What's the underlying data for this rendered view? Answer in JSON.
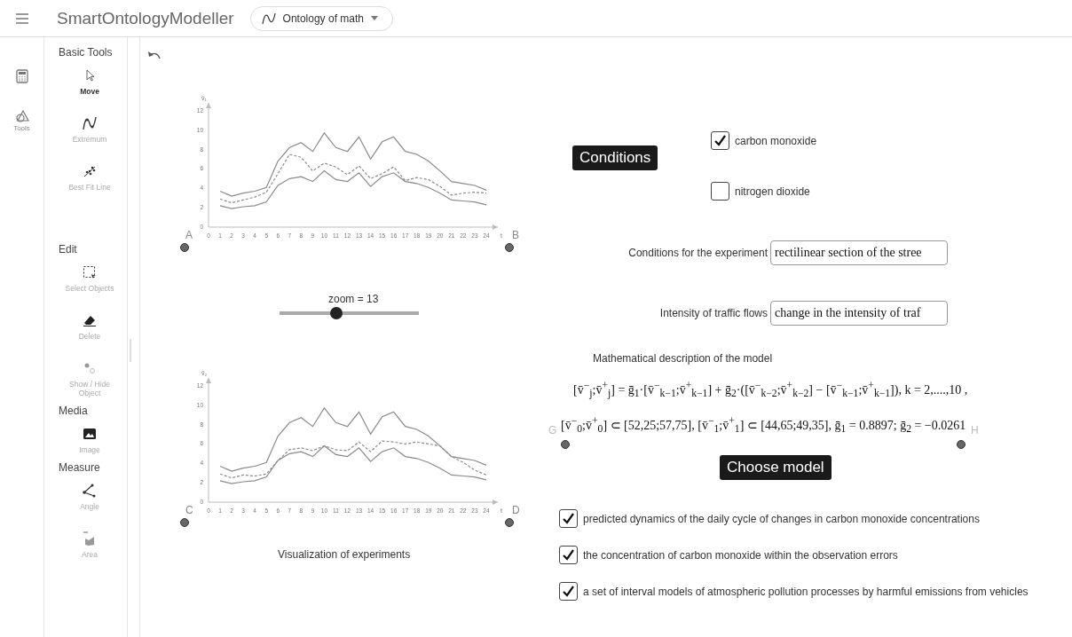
{
  "app_title": "SmartOntologyModeller",
  "file_selector": {
    "label": "Ontology of math"
  },
  "rail": [
    {
      "kind": "calculator"
    },
    {
      "kind": "tools",
      "label": "Tools"
    }
  ],
  "tool_sections": [
    {
      "title": "Basic Tools",
      "tools": [
        {
          "kind": "move",
          "label": "Move",
          "selected": true
        },
        {
          "kind": "extremum",
          "label": "Extremum",
          "selected": false
        },
        {
          "kind": "fit",
          "label": "Best Fit Line",
          "selected": false
        }
      ]
    },
    {
      "title": "Edit",
      "tools": [
        {
          "kind": "select",
          "label": "Select Objects",
          "selected": false
        },
        {
          "kind": "delete",
          "label": "Delete",
          "selected": false
        },
        {
          "kind": "showhide",
          "label": "Show / Hide Object",
          "selected": false
        }
      ]
    },
    {
      "title": "Media",
      "tools": [
        {
          "kind": "image",
          "label": "Image",
          "selected": false
        }
      ]
    },
    {
      "title": "Measure",
      "tools": [
        {
          "kind": "angle",
          "label": "Angle",
          "selected": false
        },
        {
          "kind": "area",
          "label": "Area",
          "selected": false
        }
      ]
    }
  ],
  "charts": [
    {
      "points": [
        "A",
        "B"
      ],
      "chart_data": {
        "type": "line",
        "xlabel": "t",
        "ylabel": "v̄₁",
        "x": [
          1,
          2,
          3,
          4,
          5,
          6,
          7,
          8,
          9,
          10,
          11,
          12,
          13,
          14,
          15,
          16,
          17,
          18,
          19,
          20,
          21,
          22,
          23,
          24
        ],
        "xticks": [
          0,
          1,
          2,
          3,
          4,
          5,
          6,
          7,
          8,
          9,
          10,
          11,
          12,
          13,
          14,
          15,
          16,
          17,
          18,
          19,
          20,
          21,
          22,
          23,
          24
        ],
        "yticks": [
          0,
          2,
          4,
          6,
          8,
          10,
          12
        ],
        "xlim": [
          0,
          25
        ],
        "ylim": [
          0,
          12.8
        ],
        "series": [
          {
            "color": "#8a8a8a",
            "line_style": "solid",
            "values": [
              3.7,
              3.2,
              3.5,
              3.7,
              4.1,
              6.8,
              8.2,
              8.7,
              7.8,
              9.7,
              8.2,
              7.8,
              9.3,
              7.0,
              8.8,
              9.3,
              7.8,
              7.5,
              6.8,
              5.8,
              4.7,
              4.5,
              4.3,
              3.8
            ]
          },
          {
            "color": "#8a8a8a",
            "line_style": "dashed",
            "values": [
              2.9,
              2.5,
              2.8,
              3.1,
              3.6,
              5.5,
              7.5,
              7.2,
              5.8,
              6.6,
              6.2,
              5.4,
              6.3,
              5.0,
              5.5,
              6.2,
              4.8,
              5.1,
              4.9,
              4.2,
              3.3,
              3.5,
              3.6,
              3.5
            ]
          },
          {
            "color": "#8a8a8a",
            "line_style": "solid",
            "values": [
              2.2,
              1.9,
              2.1,
              2.2,
              2.6,
              4.3,
              5.0,
              5.2,
              4.7,
              5.8,
              4.9,
              4.7,
              5.6,
              4.2,
              5.2,
              5.6,
              4.7,
              4.5,
              4.1,
              3.5,
              2.8,
              2.7,
              2.6,
              2.3
            ]
          }
        ]
      }
    },
    {
      "points": [
        "C",
        "D"
      ],
      "chart_data": {
        "type": "line",
        "xlabel": "t",
        "ylabel": "v̄₂",
        "x": [
          1,
          2,
          3,
          4,
          5,
          6,
          7,
          8,
          9,
          10,
          11,
          12,
          13,
          14,
          15,
          16,
          17,
          18,
          19,
          20,
          21,
          22,
          23,
          24
        ],
        "xticks": [
          0,
          1,
          2,
          3,
          4,
          5,
          6,
          7,
          8,
          9,
          10,
          11,
          12,
          13,
          14,
          15,
          16,
          17,
          18,
          19,
          20,
          21,
          22,
          23,
          24
        ],
        "yticks": [
          0,
          2,
          4,
          6,
          8,
          10,
          12
        ],
        "xlim": [
          0,
          25
        ],
        "ylim": [
          0,
          12.8
        ],
        "series": [
          {
            "color": "#8a8a8a",
            "line_style": "solid",
            "values": [
              3.7,
              3.2,
              3.5,
              3.7,
              4.1,
              6.8,
              8.2,
              8.7,
              7.8,
              9.7,
              8.2,
              7.8,
              9.3,
              7.0,
              8.8,
              9.3,
              7.8,
              7.5,
              6.8,
              5.8,
              4.7,
              4.5,
              4.3,
              3.8
            ]
          },
          {
            "color": "#8a8a8a",
            "line_style": "dashed",
            "values": [
              2.9,
              2.5,
              2.8,
              2.7,
              2.9,
              4.3,
              5.4,
              5.6,
              5.3,
              5.8,
              5.4,
              5.3,
              6.2,
              5.2,
              6.3,
              6.2,
              6.0,
              6.2,
              6.0,
              5.8,
              4.7,
              4.1,
              3.3,
              2.8
            ]
          },
          {
            "color": "#8a8a8a",
            "line_style": "solid",
            "values": [
              2.2,
              1.9,
              2.1,
              2.2,
              2.6,
              4.3,
              5.0,
              5.2,
              4.7,
              5.8,
              4.9,
              4.7,
              5.6,
              4.2,
              5.2,
              5.6,
              4.7,
              4.5,
              4.1,
              3.5,
              2.8,
              2.7,
              2.6,
              2.3
            ]
          }
        ]
      }
    }
  ],
  "slider": {
    "label": "zoom = 13",
    "level": 0.41
  },
  "caption": "Visualization of experiments",
  "conditions_button": "Conditions",
  "gas_checks": [
    {
      "label": "carbon monoxide",
      "checked": true
    },
    {
      "label": "nitrogen dioxide",
      "checked": false
    }
  ],
  "fields": [
    {
      "label": "Conditions for the experiment",
      "value": "rectilinear section of the stree"
    },
    {
      "label": "Intensity of traffic flows",
      "value": "change in the intensity of traf"
    }
  ],
  "model_heading": "Mathematical description of the model",
  "formulas": [
    "[v̄$^{−}$$_{j}$;v̄$^{+}$$_{j}$] = ḡ$_{1}$·[v̄$^{−}$$_{k−1}$;v̄$^{+}$$_{k−1}$] + ḡ$_{2}$·([v̄$^{−}$$_{k−2}$;v̄$^{+}$$_{k−2}$] − [v̄$^{−}$$_{k−1}$;v̄$^{+}$$_{k−1}$]), k = 2,....,10 ,",
    "[v̄$^{−}$$_{0}$;v̄$^{+}$$_{0}$] ⊂ [52,25;57,75], [v̄$^{−}$$_{1}$;v̄$^{+}$$_{1}$] ⊂ [44,65;49,35], ḡ$_{1}$ = 0.8897; ḡ$_{2}$ = −0.0261"
  ],
  "formula_points": [
    "G",
    "H"
  ],
  "choose_button": "Choose model",
  "result_checks": [
    {
      "label": "predicted dynamics of the daily cycle of changes in carbon monoxide concentrations",
      "checked": true
    },
    {
      "label": "the concentration of carbon monoxide within the observation errors",
      "checked": true
    },
    {
      "label": "a set of interval models of atmospheric pollution processes by harmful emissions from vehicles",
      "checked": true
    }
  ]
}
